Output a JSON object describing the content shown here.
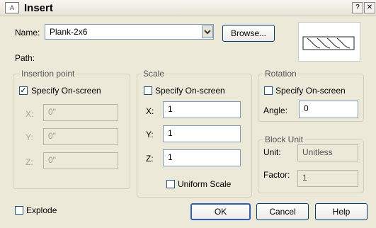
{
  "window": {
    "title": "Insert",
    "app_icon_text": "A",
    "help_glyph": "?",
    "close_glyph": "✕"
  },
  "name": {
    "label": "Name:",
    "value": "Plank-2x6"
  },
  "browse": {
    "label": "Browse..."
  },
  "path": {
    "label": "Path:"
  },
  "insertion_point": {
    "legend": "Insertion point",
    "specify_label": "Specify On-screen",
    "specify_checked": true,
    "x_label": "X:",
    "x_value": "0\"",
    "y_label": "Y:",
    "y_value": "0\"",
    "z_label": "Z:",
    "z_value": "0\""
  },
  "scale": {
    "legend": "Scale",
    "specify_label": "Specify On-screen",
    "specify_checked": false,
    "x_label": "X:",
    "x_value": "1",
    "y_label": "Y:",
    "y_value": "1",
    "z_label": "Z:",
    "z_value": "1",
    "uniform_label": "Uniform Scale",
    "uniform_checked": false
  },
  "rotation": {
    "legend": "Rotation",
    "specify_label": "Specify On-screen",
    "specify_checked": false,
    "angle_label": "Angle:",
    "angle_value": "0"
  },
  "block_unit": {
    "legend": "Block Unit",
    "unit_label": "Unit:",
    "unit_value": "Unitless",
    "factor_label": "Factor:",
    "factor_value": "1"
  },
  "explode": {
    "label": "Explode",
    "checked": false
  },
  "buttons": {
    "ok": "OK",
    "cancel": "Cancel",
    "help": "Help"
  },
  "icons": {
    "dropdown": "chevron-down-icon",
    "checkmark": "✓"
  }
}
